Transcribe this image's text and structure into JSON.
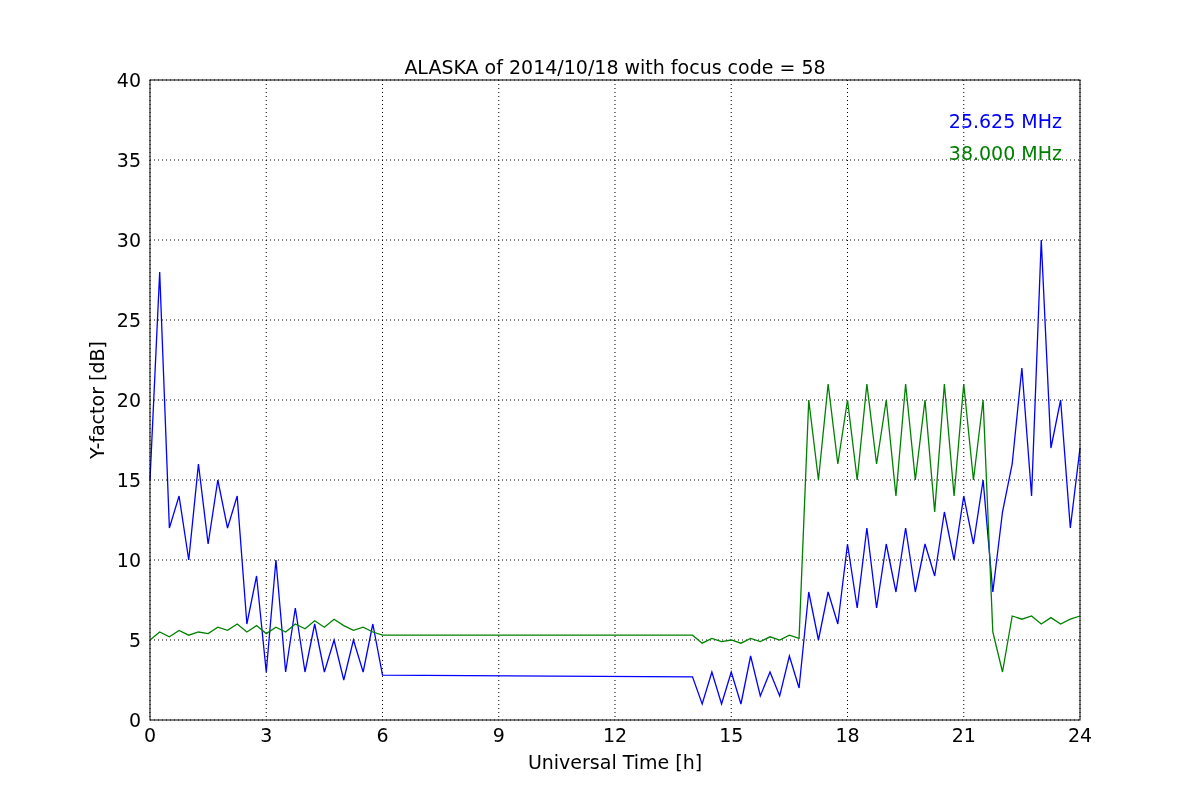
{
  "figure": {
    "chart_data": {
      "type": "line",
      "grid": true,
      "title": "ALASKA of 2014/10/18 with focus code = 58",
      "xlabel": "Universal Time [h]",
      "ylabel": "Y-factor [dB]",
      "xlim": [
        0,
        24
      ],
      "ylim": [
        0,
        40
      ],
      "xticks": [
        0,
        3,
        6,
        9,
        12,
        15,
        18,
        21,
        24
      ],
      "yticks": [
        0,
        5,
        10,
        15,
        20,
        25,
        30,
        35,
        40
      ],
      "x": [
        0,
        0.25,
        0.5,
        0.75,
        1,
        1.25,
        1.5,
        1.75,
        2,
        2.25,
        2.5,
        2.75,
        3,
        3.25,
        3.5,
        3.75,
        4,
        4.25,
        4.5,
        4.75,
        5,
        5.25,
        5.5,
        5.75,
        6,
        14,
        14.25,
        14.5,
        14.75,
        15,
        15.25,
        15.5,
        15.75,
        16,
        16.25,
        16.5,
        16.75,
        17,
        17.25,
        17.5,
        17.75,
        18,
        18.25,
        18.5,
        18.75,
        19,
        19.25,
        19.5,
        19.75,
        20,
        20.25,
        20.5,
        20.75,
        21,
        21.25,
        21.5,
        21.75,
        22,
        22.25,
        22.5,
        22.75,
        23,
        23.25,
        23.5,
        23.75,
        24
      ],
      "series": [
        {
          "name": "25.625 MHz",
          "color": "#0000ff",
          "values": [
            15,
            28,
            12,
            14,
            10,
            16,
            11,
            15,
            12,
            14,
            6,
            9,
            3,
            10,
            3,
            7,
            3,
            6,
            3,
            5,
            2.5,
            5,
            3,
            6,
            2.8,
            2.7,
            1,
            3,
            1,
            3,
            1,
            4,
            1.5,
            3,
            1.5,
            4,
            2,
            8,
            5,
            8,
            6,
            11,
            7,
            12,
            7,
            11,
            8,
            12,
            8,
            11,
            9,
            13,
            10,
            14,
            11,
            15,
            8,
            13,
            16,
            22,
            14,
            30,
            17,
            20,
            12,
            17
          ]
        },
        {
          "name": "38.000 MHz",
          "color": "#008000",
          "values": [
            5,
            5.5,
            5.2,
            5.6,
            5.3,
            5.5,
            5.4,
            5.8,
            5.6,
            6,
            5.5,
            5.9,
            5.4,
            5.8,
            5.5,
            6,
            5.7,
            6.2,
            5.8,
            6.3,
            5.9,
            5.6,
            5.8,
            5.5,
            5.3,
            5.3,
            4.8,
            5.1,
            4.9,
            5,
            4.8,
            5.1,
            4.9,
            5.2,
            5,
            5.3,
            5.1,
            20,
            15,
            21,
            16,
            20,
            15,
            21,
            16,
            20,
            14,
            21,
            15,
            20,
            13,
            21,
            14,
            21,
            15,
            20,
            5.5,
            3,
            6.5,
            6.3,
            6.5,
            6,
            6.4,
            6,
            6.3,
            6.5
          ]
        }
      ]
    }
  }
}
